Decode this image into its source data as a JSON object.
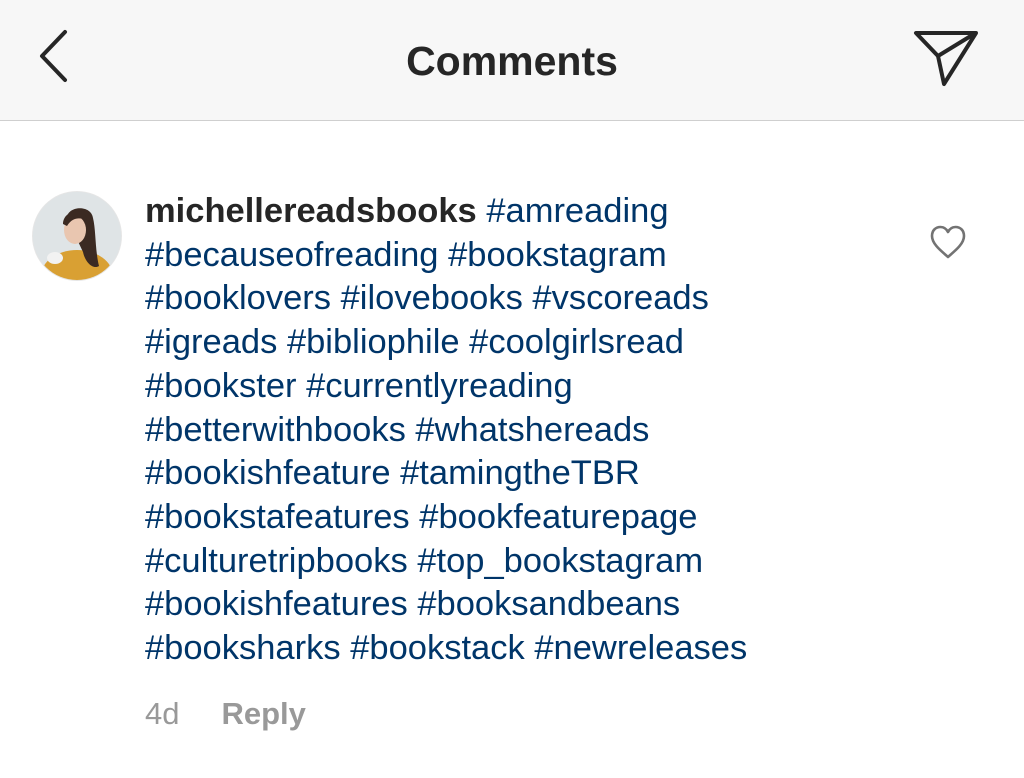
{
  "header": {
    "title": "Comments",
    "back_icon": "chevron-left-icon",
    "send_icon": "paper-plane-icon"
  },
  "comment": {
    "username": "michellereadsbooks",
    "lines": [
      [
        "#amreading"
      ],
      [
        "#becauseofreading",
        "#bookstagram"
      ],
      [
        "#booklovers",
        "#ilovebooks",
        "#vscoreads"
      ],
      [
        "#igreads",
        "#bibliophile",
        "#coolgirlsread"
      ],
      [
        "#bookster",
        "#currentlyreading"
      ],
      [
        "#betterwithbooks",
        "#whatshereads"
      ],
      [
        "#bookishfeature",
        "#tamingtheTBR"
      ],
      [
        "#bookstafeatures",
        "#bookfeaturepage"
      ],
      [
        "#culturetripbooks",
        "#top_bookstagram"
      ],
      [
        "#bookishfeatures",
        "#booksandbeans"
      ],
      [
        "#booksharks",
        "#bookstack",
        "#newreleases"
      ]
    ],
    "time": "4d",
    "reply_label": "Reply",
    "like_icon": "heart-outline-icon"
  },
  "colors": {
    "header_bg": "#f7f7f7",
    "hashtag": "#003569",
    "username": "#262626",
    "meta": "#999999"
  }
}
